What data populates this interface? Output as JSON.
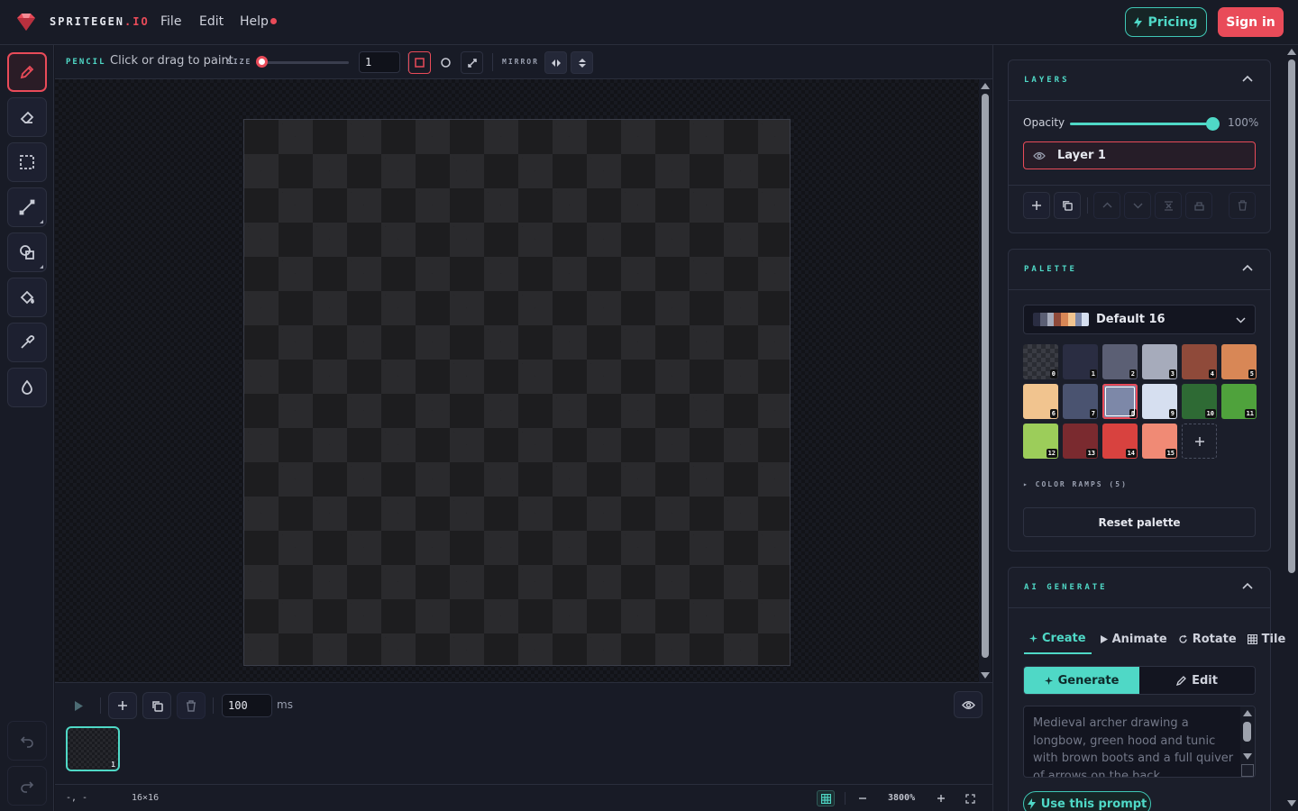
{
  "app": {
    "brand_a": "SPRITEGEN",
    "brand_b": ".IO",
    "menu": [
      "File",
      "Edit",
      "Help"
    ],
    "pricing_label": "Pricing",
    "signin_label": "Sign in"
  },
  "tool_options": {
    "tool_name": "PENCIL",
    "hint": "Click or drag to paint.",
    "size_label": "SIZE",
    "size_value": "1",
    "mirror_label": "MIRROR"
  },
  "animation": {
    "frame_ms": "100",
    "ms_label": "ms",
    "frame_number": "1"
  },
  "status": {
    "cursor": "-, -",
    "canvas_size": "16×16",
    "zoom": "3800%"
  },
  "layers": {
    "title": "LAYERS",
    "opacity_label": "Opacity",
    "opacity_value": "100%",
    "opacity_fraction": 1.0,
    "layer_name": "Layer 1"
  },
  "palette": {
    "title": "PALETTE",
    "selected_name": "Default 16",
    "color_ramps_label": "▸ COLOR RAMPS (5)",
    "reset_label": "Reset palette",
    "selected_index": 8,
    "swatches": [
      {
        "index": "0",
        "color": "transparent"
      },
      {
        "index": "1",
        "color": "#2a2d42"
      },
      {
        "index": "2",
        "color": "#5b5f74"
      },
      {
        "index": "3",
        "color": "#a6abbb"
      },
      {
        "index": "4",
        "color": "#8f4a3a"
      },
      {
        "index": "5",
        "color": "#d88756"
      },
      {
        "index": "6",
        "color": "#f1c48f"
      },
      {
        "index": "7",
        "color": "#4a5370"
      },
      {
        "index": "8",
        "color": "#7d88a8"
      },
      {
        "index": "9",
        "color": "#d6dff0"
      },
      {
        "index": "10",
        "color": "#2e6a34"
      },
      {
        "index": "11",
        "color": "#4fa23c"
      },
      {
        "index": "12",
        "color": "#9ccd5a"
      },
      {
        "index": "13",
        "color": "#7a2a2f"
      },
      {
        "index": "14",
        "color": "#d8423f"
      },
      {
        "index": "15",
        "color": "#f08a75"
      }
    ]
  },
  "ai": {
    "title": "AI GENERATE",
    "tabs": [
      "Create",
      "Animate",
      "Rotate",
      "Tile"
    ],
    "generate_label": "Generate",
    "edit_label": "Edit",
    "prompt_placeholder": "Medieval archer drawing a longbow, green hood and tunic with brown boots and a full quiver of arrows on the back",
    "use_prompt_label": "Use this prompt"
  },
  "colors": {
    "accent": "#4fd8c6",
    "brand": "#e94b59"
  }
}
